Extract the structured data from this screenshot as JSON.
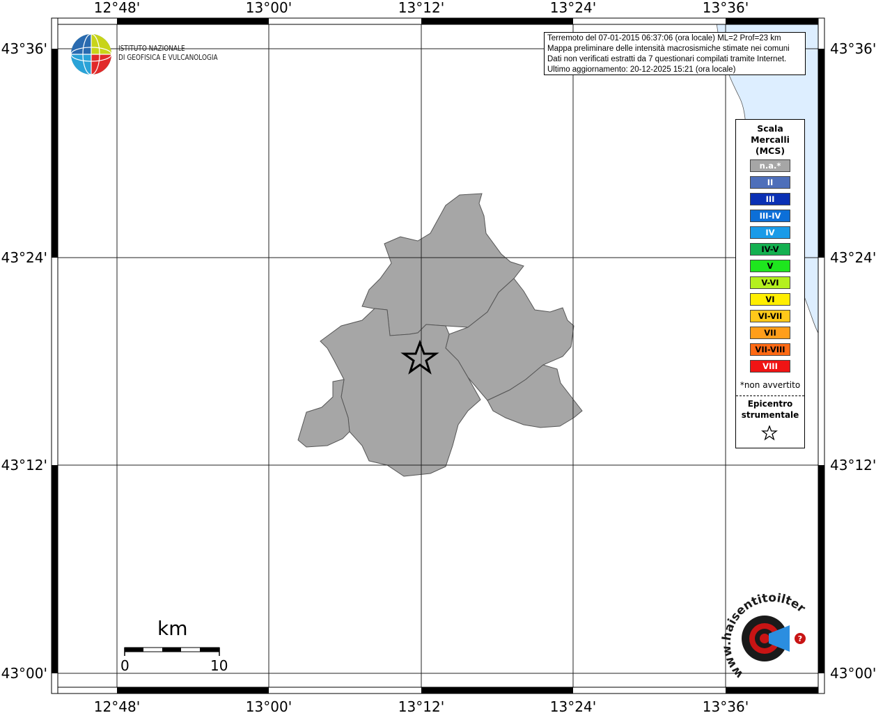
{
  "map": {
    "longitude_ticks": [
      "12°48'",
      "13°00'",
      "13°12'",
      "13°24'",
      "13°36'"
    ],
    "latitude_ticks": [
      "43°36'",
      "43°24'",
      "43°12'",
      "43°00'"
    ]
  },
  "info": {
    "line1": "Terremoto del 07-01-2015 06:37:06 (ora locale) ML=2 Prof=23 km",
    "line2": "Mappa preliminare delle intensità macrosismiche stimate nei comuni",
    "line3": "Dati non verificati estratti da 7 questionari compilati tramite Internet.",
    "line4": "Ultimo aggiornamento: 20-12-2025 15:21 (ora locale)"
  },
  "ingv_logo": {
    "line1": "ISTITUTO NAZIONALE",
    "line2": "DI GEOFISICA E VULCANOLOGIA"
  },
  "legend": {
    "title_line1": "Scala",
    "title_line2": "Mercalli",
    "title_line3": "(MCS)",
    "items": [
      {
        "label": "n.a.*",
        "color": "#a6a6a6",
        "text_color": "#ffffff"
      },
      {
        "label": "II",
        "color": "#4e6fba",
        "text_color": "#ffffff"
      },
      {
        "label": "III",
        "color": "#0a30b4",
        "text_color": "#ffffff"
      },
      {
        "label": "III-IV",
        "color": "#0c6fd8",
        "text_color": "#ffffff"
      },
      {
        "label": "IV",
        "color": "#1a9be8",
        "text_color": "#ffffff"
      },
      {
        "label": "IV-V",
        "color": "#14b050",
        "text_color": "#000000"
      },
      {
        "label": "V",
        "color": "#1ee61e",
        "text_color": "#000000"
      },
      {
        "label": "V-VI",
        "color": "#b4f01e",
        "text_color": "#000000"
      },
      {
        "label": "VI",
        "color": "#ffee00",
        "text_color": "#000000"
      },
      {
        "label": "VI-VII",
        "color": "#ffc81a",
        "text_color": "#000000"
      },
      {
        "label": "VII",
        "color": "#ff9e1a",
        "text_color": "#000000"
      },
      {
        "label": "VII-VIII",
        "color": "#ff6a14",
        "text_color": "#000000"
      },
      {
        "label": "VIII",
        "color": "#f01414",
        "text_color": "#ffffff"
      }
    ],
    "note": "*non avvertito",
    "epicenter_line1": "Epicentro",
    "epicenter_line2": "strumentale"
  },
  "scalebar": {
    "unit": "km",
    "min_label": "0",
    "max_label": "10"
  },
  "site_logo": {
    "text": "www.haisentitoilterremoto.it"
  },
  "colors": {
    "municipality_fill": "#a6a6a6",
    "sea": "#ddeeff"
  }
}
